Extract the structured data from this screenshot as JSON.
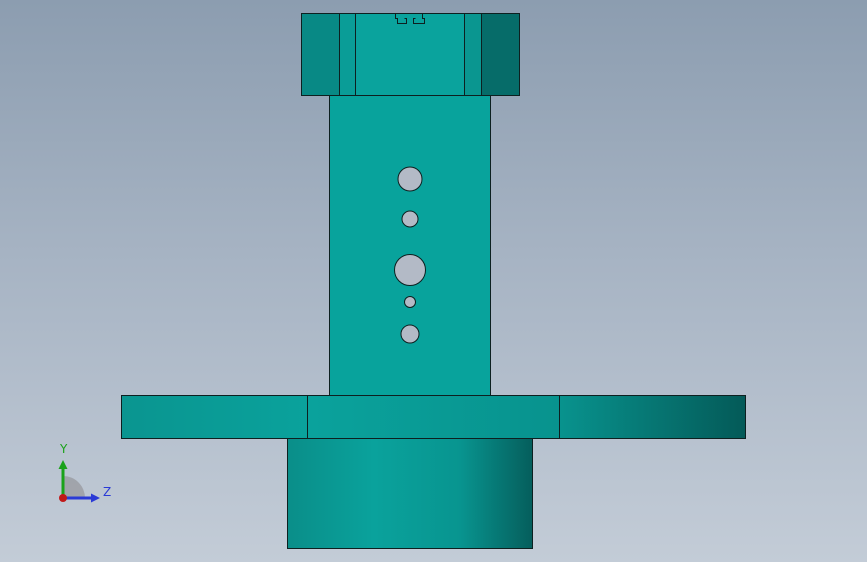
{
  "viewport": {
    "background_top": "#8c9db0",
    "background_bottom": "#c3ccd7"
  },
  "model": {
    "body_color": "#08a39c",
    "edge_color": "#0d2020",
    "hole_color": "#b3bac6"
  },
  "triad": {
    "y_label": "Y",
    "z_label": "Z",
    "y_color": "#1aa21a",
    "z_color": "#2a3ad6",
    "origin_color": "#c01818"
  }
}
